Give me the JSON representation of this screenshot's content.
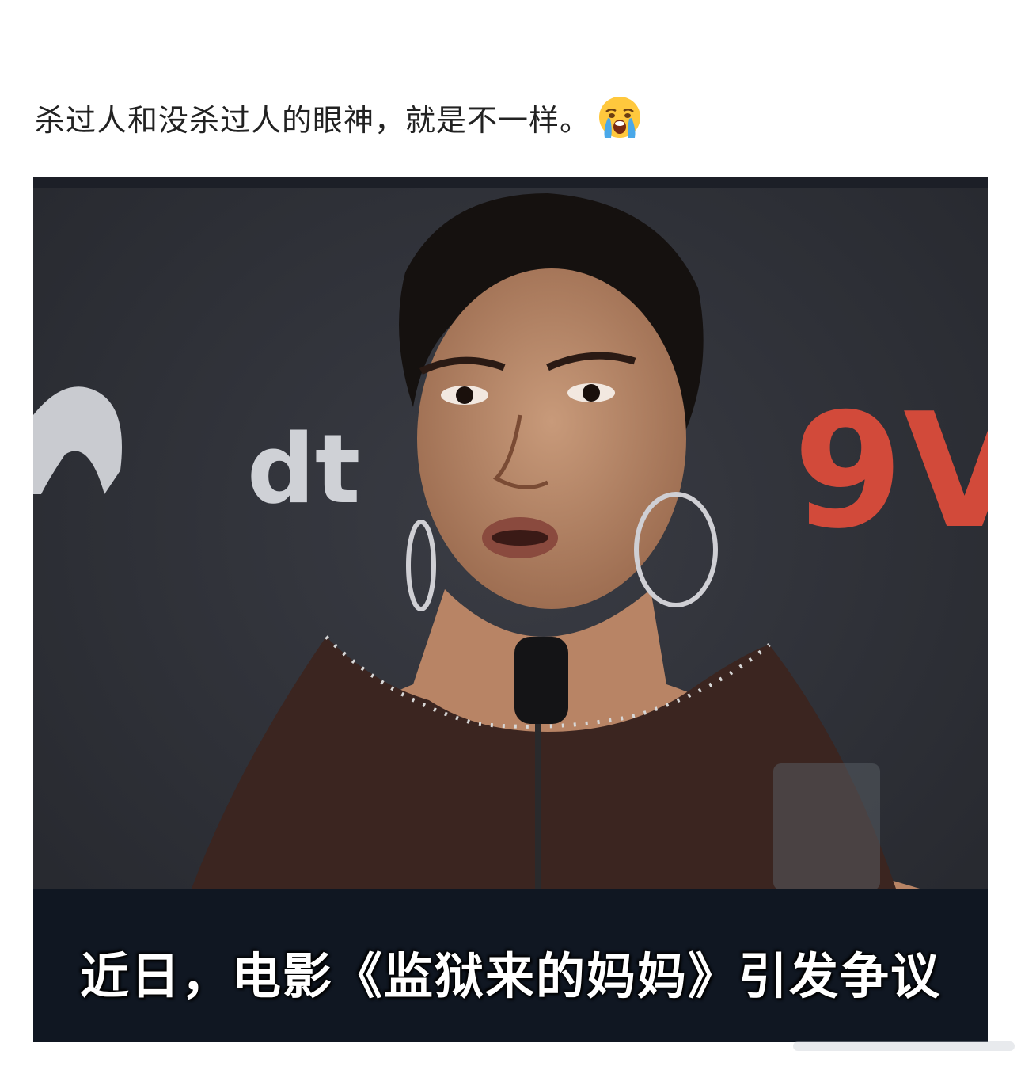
{
  "post": {
    "text": "杀过人和没杀过人的眼神，就是不一样。",
    "emoji": "loudly-crying-face"
  },
  "video": {
    "subtitle": "近日，电影《监狱来的妈妈》引发争议",
    "backdrop_logo_left": "dt",
    "backdrop_logo_right": "9V"
  }
}
